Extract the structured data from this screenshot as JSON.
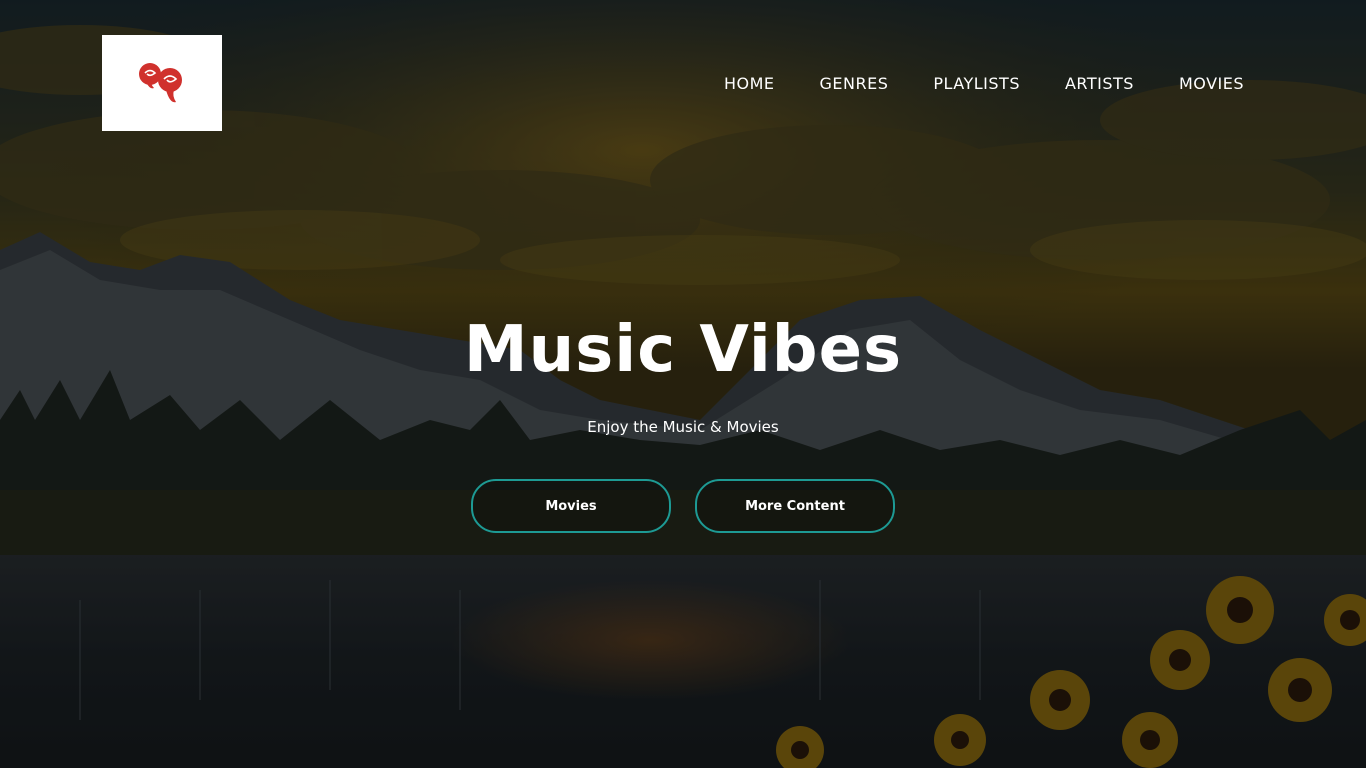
{
  "header": {
    "logo_icon": "roses-logo-icon",
    "nav": [
      {
        "label": "HOME"
      },
      {
        "label": "GENRES"
      },
      {
        "label": "PLAYLISTS"
      },
      {
        "label": "ARTISTS"
      },
      {
        "label": "MOVIES"
      }
    ]
  },
  "hero": {
    "title": "Music Vibes",
    "subtitle": "Enjoy the Music & Movies",
    "primary_button": "Movies",
    "secondary_button": "More Content",
    "background_image": "sunset-mountain-lake-icon"
  },
  "colors": {
    "accent_border": "#1d9a94",
    "logo_red": "#d0312d",
    "text": "#ffffff"
  }
}
